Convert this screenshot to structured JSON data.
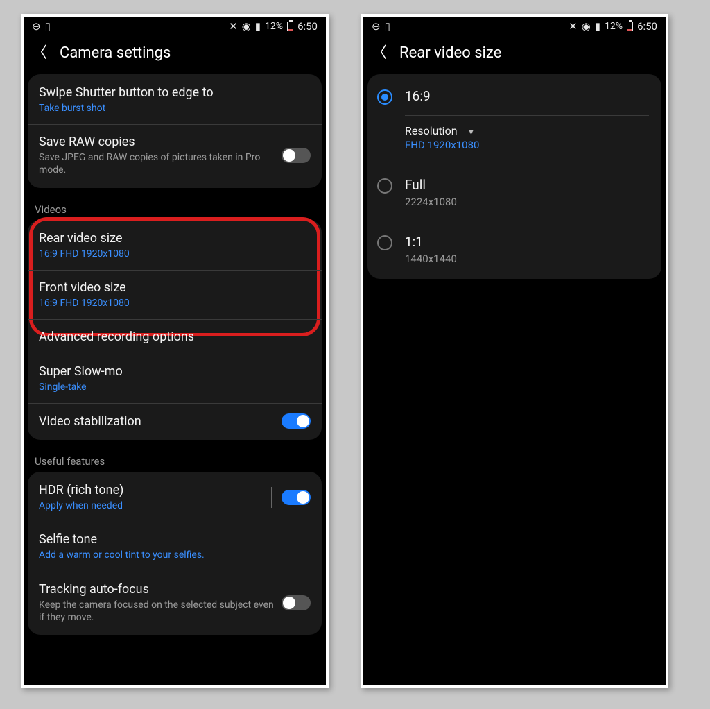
{
  "status": {
    "battery": "12%",
    "time": "6:50"
  },
  "left": {
    "title": "Camera settings",
    "swipe": {
      "title": "Swipe Shutter button to edge to",
      "sub": "Take burst shot"
    },
    "raw": {
      "title": "Save RAW copies",
      "sub": "Save JPEG and RAW copies of pictures taken in Pro mode."
    },
    "videos_header": "Videos",
    "rear": {
      "title": "Rear video size",
      "sub": "16:9 FHD 1920x1080"
    },
    "front": {
      "title": "Front video size",
      "sub": "16:9 FHD 1920x1080"
    },
    "adv": {
      "title": "Advanced recording options"
    },
    "slowmo": {
      "title": "Super Slow-mo",
      "sub": "Single-take"
    },
    "stab": {
      "title": "Video stabilization"
    },
    "useful_header": "Useful features",
    "hdr": {
      "title": "HDR (rich tone)",
      "sub": "Apply when needed"
    },
    "selfie": {
      "title": "Selfie tone",
      "sub": "Add a warm or cool tint to your selfies."
    },
    "track": {
      "title": "Tracking auto-focus",
      "sub": "Keep the camera focused on the selected subject even if they move."
    }
  },
  "right": {
    "title": "Rear video size",
    "opt169": {
      "label": "16:9",
      "res_label": "Resolution",
      "res_value": "FHD 1920x1080"
    },
    "optfull": {
      "label": "Full",
      "sub": "2224x1080"
    },
    "opt11": {
      "label": "1:1",
      "sub": "1440x1440"
    }
  }
}
